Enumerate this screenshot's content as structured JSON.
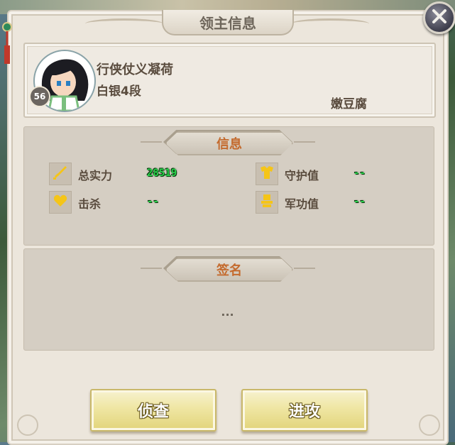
{
  "dialog": {
    "title": "领主信息"
  },
  "profile": {
    "player_name": "行侠仗义凝荷",
    "rank": "白银4段",
    "level": "56",
    "guild": "嫩豆腐"
  },
  "info_section": {
    "title": "信息",
    "stats": [
      {
        "label": "总实力",
        "value": "28519",
        "icon": "sword-icon"
      },
      {
        "label": "击杀",
        "value": "--",
        "icon": "heart-icon"
      },
      {
        "label": "守护值",
        "value": "--",
        "icon": "armor-icon"
      },
      {
        "label": "军功值",
        "value": "--",
        "icon": "medal-icon"
      }
    ]
  },
  "signature_section": {
    "title": "签名",
    "text": "..."
  },
  "actions": {
    "scout_label": "侦查",
    "attack_label": "进攻"
  },
  "colors": {
    "section_title": "#c46a2d",
    "stat_value": "#2ad24c",
    "button_gold": "#efe6a3"
  }
}
